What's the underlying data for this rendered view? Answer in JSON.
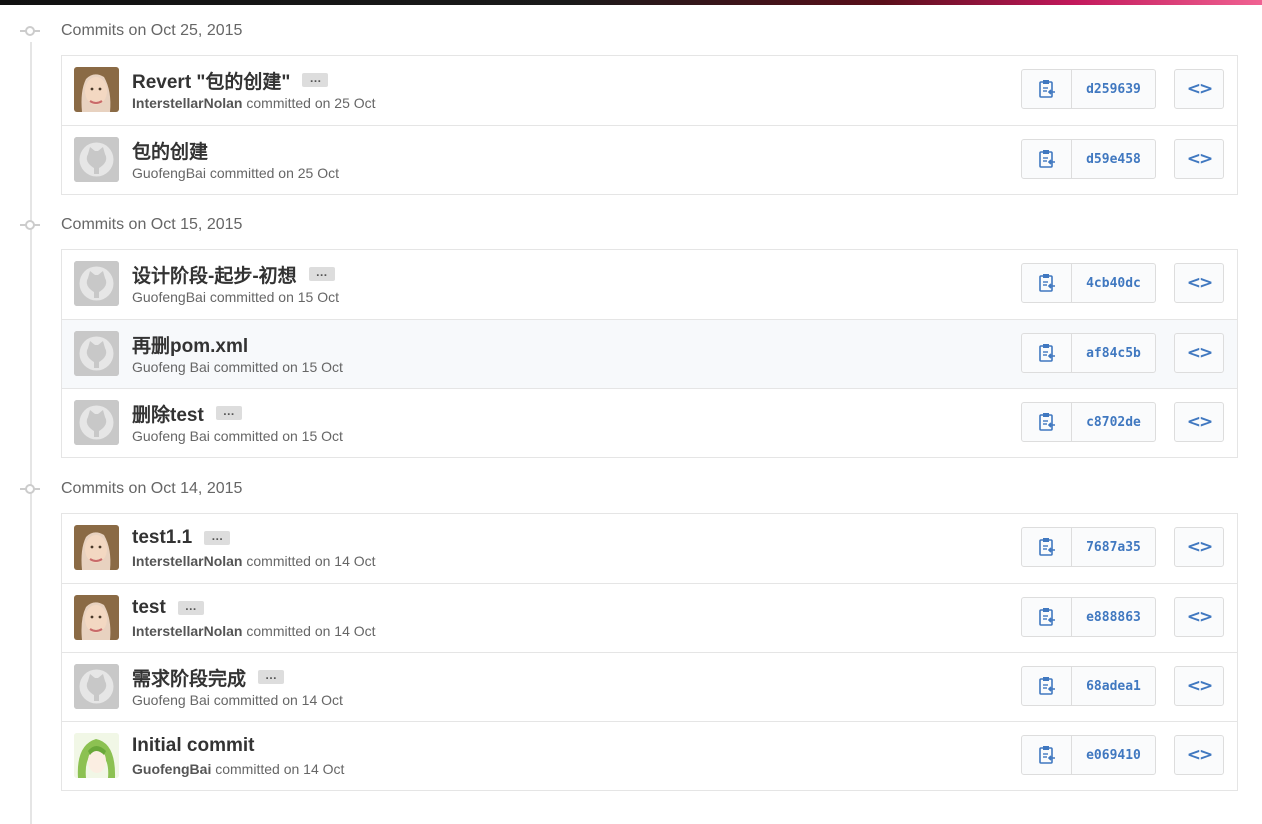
{
  "colors": {
    "accent": "#4078c0",
    "border": "#e5e5e5",
    "text": "#333333",
    "muted": "#666666"
  },
  "icons": {
    "clipboard": "clipboard-icon",
    "browse": "code-icon",
    "timeline": "commit-node-icon"
  },
  "groups": [
    {
      "title": "Commits on Oct 25, 2015",
      "commits": [
        {
          "message": "Revert \"包的创建\"",
          "has_ellipsis": true,
          "ellipsis": "…",
          "author": "InterstellarNolan",
          "author_bold": true,
          "suffix": " committed on 25 Oct",
          "sha": "d259639",
          "avatar": "photo",
          "browse": "<>"
        },
        {
          "message": "包的创建",
          "has_ellipsis": false,
          "author": "GuofengBai",
          "author_bold": false,
          "suffix": " committed on 25 Oct",
          "sha": "d59e458",
          "avatar": "octo",
          "browse": "<>"
        }
      ]
    },
    {
      "title": "Commits on Oct 15, 2015",
      "commits": [
        {
          "message": "设计阶段-起步-初想",
          "has_ellipsis": true,
          "ellipsis": "…",
          "author": "GuofengBai",
          "author_bold": false,
          "suffix": " committed on 15 Oct",
          "sha": "4cb40dc",
          "avatar": "octo",
          "browse": "<>"
        },
        {
          "message": "再删pom.xml",
          "has_ellipsis": false,
          "author": "Guofeng Bai",
          "author_bold": false,
          "suffix": " committed on 15 Oct",
          "sha": "af84c5b",
          "avatar": "octo",
          "browse": "<>"
        },
        {
          "message": "删除test",
          "has_ellipsis": true,
          "ellipsis": "…",
          "author": "Guofeng Bai",
          "author_bold": false,
          "suffix": " committed on 15 Oct",
          "sha": "c8702de",
          "avatar": "octo",
          "browse": "<>"
        }
      ]
    },
    {
      "title": "Commits on Oct 14, 2015",
      "commits": [
        {
          "message": "test1.1",
          "has_ellipsis": true,
          "ellipsis": "…",
          "author": "InterstellarNolan",
          "author_bold": true,
          "suffix": " committed on 14 Oct",
          "sha": "7687a35",
          "avatar": "photo",
          "browse": "<>"
        },
        {
          "message": "test",
          "has_ellipsis": true,
          "ellipsis": "…",
          "author": "InterstellarNolan",
          "author_bold": true,
          "suffix": " committed on 14 Oct",
          "sha": "e888863",
          "avatar": "photo",
          "browse": "<>"
        },
        {
          "message": "需求阶段完成",
          "has_ellipsis": true,
          "ellipsis": "…",
          "author": "Guofeng Bai",
          "author_bold": false,
          "suffix": " committed on 14 Oct",
          "sha": "68adea1",
          "avatar": "octo",
          "browse": "<>"
        },
        {
          "message": "Initial commit",
          "has_ellipsis": false,
          "author": "GuofengBai",
          "author_bold": true,
          "suffix": " committed on 14 Oct",
          "sha": "e069410",
          "avatar": "anime",
          "browse": "<>"
        }
      ]
    }
  ]
}
